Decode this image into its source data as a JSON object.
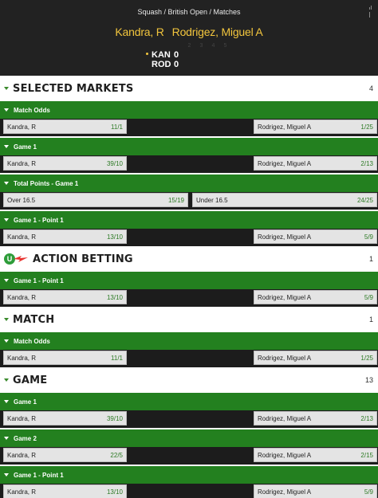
{
  "header": {
    "breadcrumb": "Squash / British Open / Matches",
    "player1": "Kandra, R",
    "player2": "Rodrigez, Miguel A",
    "set_columns": [
      "2",
      "3",
      "4",
      "5"
    ],
    "scores": [
      {
        "abbr": "KAN",
        "value": "0",
        "serving": true
      },
      {
        "abbr": "ROD",
        "value": "0",
        "serving": false
      }
    ]
  },
  "sections": {
    "selected": {
      "title": "SELECTED MARKETS",
      "count": "4",
      "markets": [
        {
          "name": "Match Odds",
          "left": {
            "label": "Kandra, R",
            "odds": "11/1"
          },
          "right": {
            "label": "Rodrigez, Miguel A",
            "odds": "1/25"
          }
        },
        {
          "name": "Game 1",
          "left": {
            "label": "Kandra, R",
            "odds": "39/10"
          },
          "right": {
            "label": "Rodrigez, Miguel A",
            "odds": "2/13"
          }
        },
        {
          "name": "Total Points - Game 1",
          "left": {
            "label": "Over 16.5",
            "odds": "15/19"
          },
          "right": {
            "label": "Under 16.5",
            "odds": "24/25"
          }
        },
        {
          "name": "Game 1 - Point 1",
          "left": {
            "label": "Kandra, R",
            "odds": "13/10"
          },
          "right": {
            "label": "Rodrigez, Miguel A",
            "odds": "5/9"
          }
        }
      ]
    },
    "action": {
      "logo_letter": "U",
      "title": "ACTION BETTING",
      "count": "1",
      "markets": [
        {
          "name": "Game 1 - Point 1",
          "left": {
            "label": "Kandra, R",
            "odds": "13/10"
          },
          "right": {
            "label": "Rodrigez, Miguel A",
            "odds": "5/9"
          }
        }
      ]
    },
    "match": {
      "title": "MATCH",
      "count": "1",
      "markets": [
        {
          "name": "Match Odds",
          "left": {
            "label": "Kandra, R",
            "odds": "11/1"
          },
          "right": {
            "label": "Rodrigez, Miguel A",
            "odds": "1/25"
          }
        }
      ]
    },
    "game": {
      "title": "GAME",
      "count": "13",
      "markets": [
        {
          "name": "Game 1",
          "left": {
            "label": "Kandra, R",
            "odds": "39/10"
          },
          "right": {
            "label": "Rodrigez, Miguel A",
            "odds": "2/13"
          }
        },
        {
          "name": "Game 2",
          "left": {
            "label": "Kandra, R",
            "odds": "22/5"
          },
          "right": {
            "label": "Rodrigez, Miguel A",
            "odds": "2/15"
          }
        },
        {
          "name": "Game 1 - Point 1",
          "left": {
            "label": "Kandra, R",
            "odds": "13/10"
          },
          "right": {
            "label": "Rodrigez, Miguel A",
            "odds": "5/9"
          }
        }
      ]
    }
  },
  "colors": {
    "accent": "#23801f",
    "odds": "#2c7a24",
    "title": "#f2c53d"
  }
}
